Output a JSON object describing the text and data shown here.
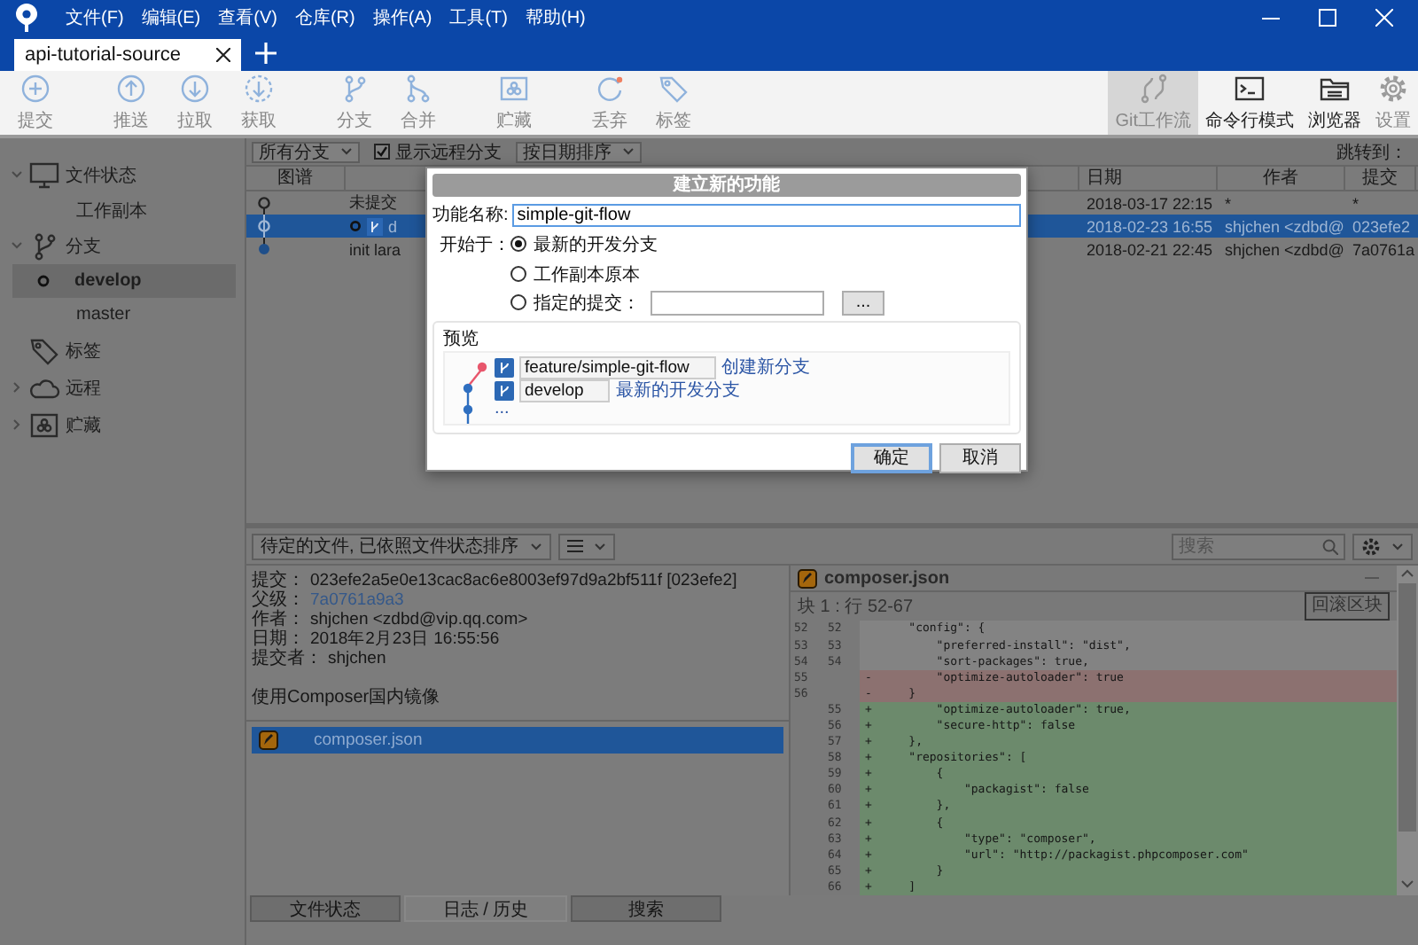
{
  "menu": [
    "文件(F)",
    "编辑(E)",
    "查看(V)",
    "仓库(R)",
    "操作(A)",
    "工具(T)",
    "帮助(H)"
  ],
  "tabs": [
    {
      "label": "api-tutorial-source",
      "selected": true
    }
  ],
  "toolbar": {
    "groups": [
      [
        {
          "kind": "commit",
          "label": "提交",
          "disabled": true
        }
      ],
      [
        {
          "kind": "push",
          "label": "推送",
          "disabled": true
        },
        {
          "kind": "pull",
          "label": "拉取",
          "disabled": true
        },
        {
          "kind": "fetch",
          "label": "获取",
          "disabled": true
        }
      ],
      [
        {
          "kind": "branch",
          "label": "分支",
          "disabled": true
        },
        {
          "kind": "merge",
          "label": "合并",
          "disabled": true
        }
      ],
      [
        {
          "kind": "stash",
          "label": "贮藏",
          "disabled": true
        }
      ],
      [
        {
          "kind": "discard",
          "label": "丢弃",
          "disabled": true
        },
        {
          "kind": "tag",
          "label": "标签",
          "disabled": true
        }
      ]
    ],
    "right": [
      {
        "kind": "gitflow",
        "label": "Git工作流",
        "selected": true,
        "disabled": true
      },
      {
        "kind": "terminal",
        "label": "命令行模式",
        "selected": false,
        "disabled": false
      },
      {
        "kind": "browser",
        "label": "浏览器",
        "selected": false,
        "disabled": false
      },
      {
        "kind": "settings",
        "label": "设置",
        "selected": false,
        "disabled": true
      }
    ]
  },
  "sidebar": [
    {
      "label": "文件状态",
      "kind": "files",
      "expanded": true,
      "children": [
        {
          "label": "工作副本",
          "selected": false,
          "current": false
        }
      ]
    },
    {
      "label": "分支",
      "kind": "branch",
      "expanded": true,
      "children": [
        {
          "label": "develop",
          "selected": true,
          "current": true
        },
        {
          "label": "master",
          "selected": false,
          "current": false
        }
      ]
    },
    {
      "label": "标签",
      "kind": "tag"
    },
    {
      "label": "远程",
      "kind": "remote",
      "expanded": false
    },
    {
      "label": "贮藏",
      "kind": "stash",
      "expanded": false
    }
  ],
  "history": {
    "branch_filter": "所有分支",
    "show_remote": {
      "label": "显示远程分支",
      "checked": true
    },
    "sort": "按日期排序",
    "jump_label": "跳转到：",
    "columns": {
      "graph": "图谱",
      "date": "日期",
      "author": "作者",
      "commit": "提交"
    },
    "rows": [
      {
        "kind": "hollow",
        "head": false,
        "description": "未提交",
        "date": "2018-03-17 22:15",
        "author": "*",
        "commit": "*",
        "selected": false
      },
      {
        "kind": "hollow",
        "head": true,
        "branch": "d",
        "date": "2018-02-23 16:55",
        "author": "shjchen <zdbd@",
        "commit": "023efe2",
        "selected": true
      },
      {
        "kind": "filled",
        "head": false,
        "description": "init lara",
        "date": "2018-02-21 22:45",
        "author": "shjchen <zdbd@",
        "commit": "7a0761a",
        "selected": false
      }
    ]
  },
  "details": {
    "file_filter": "待定的文件, 已依照文件状态排序",
    "fields": [
      {
        "label": "提交：",
        "value": "023efe2a5e0e13cac8ac6e8003ef97d9a2bf511f [023efe2]",
        "kind": "text"
      },
      {
        "label": "父级：",
        "value": "7a0761a9a3",
        "kind": "link"
      },
      {
        "label": "作者：",
        "value": "shjchen <zdbd@vip.qq.com>",
        "kind": "text"
      },
      {
        "label": "日期：",
        "value": "2018年2月23日 16:55:56",
        "kind": "text"
      },
      {
        "label": "提交者：",
        "value": "shjchen",
        "kind": "text"
      }
    ],
    "message": "使用Composer国内镜像",
    "files": [
      {
        "name": "composer.json",
        "kind": "modified",
        "selected": true
      }
    ]
  },
  "diff": {
    "search_placeholder": "搜索",
    "file": {
      "name": "composer.json",
      "kind": "modified"
    },
    "hunk": {
      "title": "块 1 : 行 52-67",
      "button": "回滚区块"
    },
    "lines": [
      {
        "kind": "context",
        "old": "52",
        "new": "52",
        "text": "    \"config\": {"
      },
      {
        "kind": "context",
        "old": "53",
        "new": "53",
        "text": "        \"preferred-install\": \"dist\","
      },
      {
        "kind": "context",
        "old": "54",
        "new": "54",
        "text": "        \"sort-packages\": true,"
      },
      {
        "kind": "removed",
        "old": "55",
        "sign": "-",
        "text": "        \"optimize-autoloader\": true"
      },
      {
        "kind": "removed",
        "old": "56",
        "sign": "-",
        "text": "    }"
      },
      {
        "kind": "added",
        "new": "55",
        "sign": "+",
        "text": "        \"optimize-autoloader\": true,"
      },
      {
        "kind": "added",
        "new": "56",
        "sign": "+",
        "text": "        \"secure-http\": false"
      },
      {
        "kind": "added",
        "new": "57",
        "sign": "+",
        "text": "    },"
      },
      {
        "kind": "added",
        "new": "58",
        "sign": "+",
        "text": "    \"repositories\": ["
      },
      {
        "kind": "added",
        "new": "59",
        "sign": "+",
        "text": "        {"
      },
      {
        "kind": "added",
        "new": "60",
        "sign": "+",
        "text": "            \"packagist\": false"
      },
      {
        "kind": "added",
        "new": "61",
        "sign": "+",
        "text": "        },"
      },
      {
        "kind": "added",
        "new": "62",
        "sign": "+",
        "text": "        {"
      },
      {
        "kind": "added",
        "new": "63",
        "sign": "+",
        "text": "            \"type\": \"composer\","
      },
      {
        "kind": "added",
        "new": "64",
        "sign": "+",
        "text": "            \"url\": \"http://packagist.phpcomposer.com\""
      },
      {
        "kind": "added",
        "new": "65",
        "sign": "+",
        "text": "        }"
      },
      {
        "kind": "added",
        "new": "66",
        "sign": "+",
        "text": "    ]"
      }
    ]
  },
  "bottom_tabs": [
    {
      "label": "文件状态",
      "selected": false
    },
    {
      "label": "日志 / 历史",
      "selected": true
    },
    {
      "label": "搜索",
      "selected": false
    }
  ],
  "dialog": {
    "title": "建立新的功能",
    "name_label": "功能名称:",
    "name_value": "simple-git-flow",
    "start_label": "开始于：",
    "start_options": [
      {
        "label": "最新的开发分支",
        "selected": true,
        "kind": "plain"
      },
      {
        "label": "工作副本原本",
        "selected": false,
        "kind": "plain"
      },
      {
        "label": "指定的提交：",
        "selected": false,
        "kind": "commit"
      }
    ],
    "browse_button": "...",
    "preview": {
      "title": "预览",
      "branches": [
        {
          "name": "feature/simple-git-flow",
          "note": "创建新分支",
          "color": "#e8566c"
        },
        {
          "name": "develop",
          "note": "最新的开发分支",
          "color": "#2f6fc0"
        }
      ],
      "more": "..."
    },
    "buttons": [
      {
        "label": "确定",
        "default": true
      },
      {
        "label": "取消",
        "default": false
      }
    ]
  }
}
